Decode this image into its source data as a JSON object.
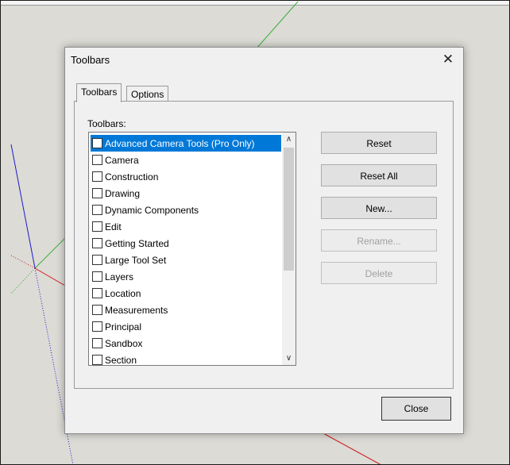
{
  "colors": {
    "canvas": "#dcdbd6",
    "selection": "#0078d7",
    "axis_green": "#3fae3a",
    "axis_blue": "#1c1cc8",
    "axis_red": "#cc1c1c"
  },
  "dialog": {
    "title": "Toolbars",
    "close_glyph": "✕",
    "tabs": [
      {
        "label": "Toolbars",
        "active": true
      },
      {
        "label": "Options",
        "active": false
      }
    ],
    "list_label": "Toolbars:",
    "items": [
      {
        "label": "Advanced Camera Tools (Pro Only)",
        "checked": false,
        "selected": true
      },
      {
        "label": "Camera",
        "checked": false,
        "selected": false
      },
      {
        "label": "Construction",
        "checked": false,
        "selected": false
      },
      {
        "label": "Drawing",
        "checked": false,
        "selected": false
      },
      {
        "label": "Dynamic Components",
        "checked": false,
        "selected": false
      },
      {
        "label": "Edit",
        "checked": false,
        "selected": false
      },
      {
        "label": "Getting Started",
        "checked": false,
        "selected": false
      },
      {
        "label": "Large Tool Set",
        "checked": false,
        "selected": false
      },
      {
        "label": "Layers",
        "checked": false,
        "selected": false
      },
      {
        "label": "Location",
        "checked": false,
        "selected": false
      },
      {
        "label": "Measurements",
        "checked": false,
        "selected": false
      },
      {
        "label": "Principal",
        "checked": false,
        "selected": false
      },
      {
        "label": "Sandbox",
        "checked": false,
        "selected": false
      },
      {
        "label": "Section",
        "checked": false,
        "selected": false
      }
    ],
    "scroll_up_glyph": "∧",
    "scroll_down_glyph": "∨",
    "buttons": {
      "reset": {
        "label": "Reset",
        "enabled": true
      },
      "reset_all": {
        "label": "Reset All",
        "enabled": true
      },
      "new": {
        "label": "New...",
        "enabled": true
      },
      "rename": {
        "label": "Rename...",
        "enabled": false
      },
      "delete": {
        "label": "Delete",
        "enabled": false
      }
    },
    "close_button": "Close"
  }
}
